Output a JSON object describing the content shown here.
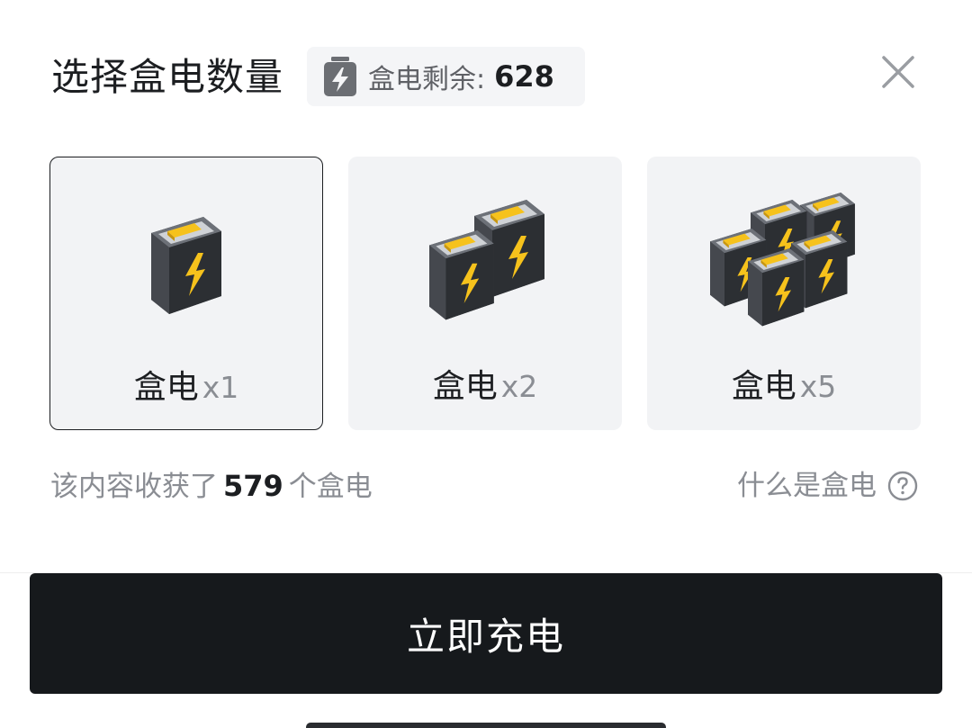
{
  "header": {
    "title": "选择盒电数量",
    "balance_label": "盒电剩余:",
    "balance_value": "628",
    "balance_icon": "battery-bolt-icon",
    "close_icon": "close-icon"
  },
  "options": [
    {
      "name": "盒电",
      "qty": "x1",
      "selected": true
    },
    {
      "name": "盒电",
      "qty": "x2",
      "selected": false
    },
    {
      "name": "盒电",
      "qty": "x5",
      "selected": false
    }
  ],
  "footer": {
    "earned_prefix": "该内容收获了",
    "earned_count": "579",
    "earned_suffix": "个盒电",
    "help_label": "什么是盒电",
    "help_icon": "question-circle-icon"
  },
  "action": {
    "charge_label": "立即充电"
  },
  "colors": {
    "button_bg": "#16191c",
    "card_bg": "#f2f3f5",
    "battery_gold": "#f6c21c"
  }
}
